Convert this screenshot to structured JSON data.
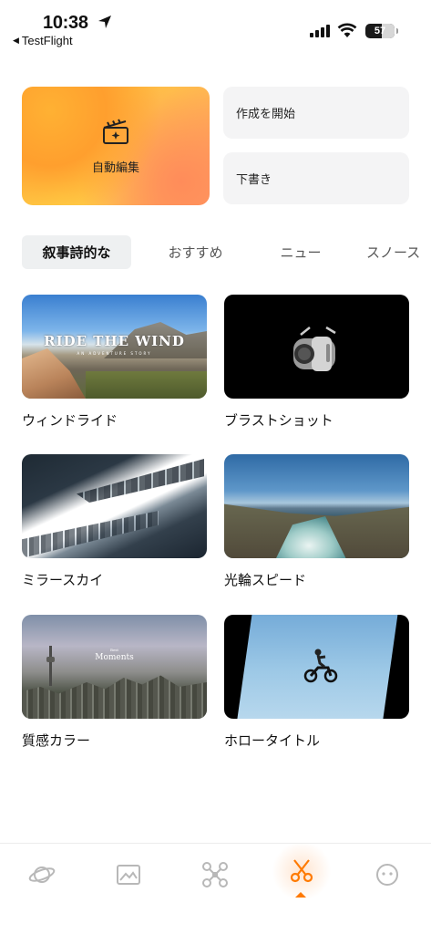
{
  "status_bar": {
    "time": "10:38",
    "back_app": "TestFlight",
    "battery": "57"
  },
  "top_cards": {
    "auto_edit": "自動編集",
    "start_creating": "作成を開始",
    "drafts": "下書き"
  },
  "tabs": [
    {
      "label": "叙事詩的な",
      "active": true
    },
    {
      "label": "おすすめ",
      "active": false
    },
    {
      "label": "ニュー",
      "active": false
    },
    {
      "label": "スノース",
      "active": false
    }
  ],
  "templates": [
    {
      "name": "ウィンドライド",
      "thumb_title": "RIDE THE WIND",
      "thumb_subtitle": "AN ADVENTURE STORY"
    },
    {
      "name": "ブラストショット"
    },
    {
      "name": "ミラースカイ"
    },
    {
      "name": "光輪スピード"
    },
    {
      "name": "質感カラー",
      "thumb_small": "Best",
      "thumb_title": "Moments"
    },
    {
      "name": "ホロータイトル"
    }
  ],
  "tab_bar": [
    {
      "icon": "planet-icon",
      "active": false
    },
    {
      "icon": "gallery-icon",
      "active": false
    },
    {
      "icon": "drone-icon",
      "active": false
    },
    {
      "icon": "scissors-icon",
      "active": true
    },
    {
      "icon": "profile-icon",
      "active": false
    }
  ],
  "colors": {
    "accent": "#ff7a00",
    "card_bg": "#f4f4f5",
    "tab_active_bg": "#eef0f1"
  }
}
